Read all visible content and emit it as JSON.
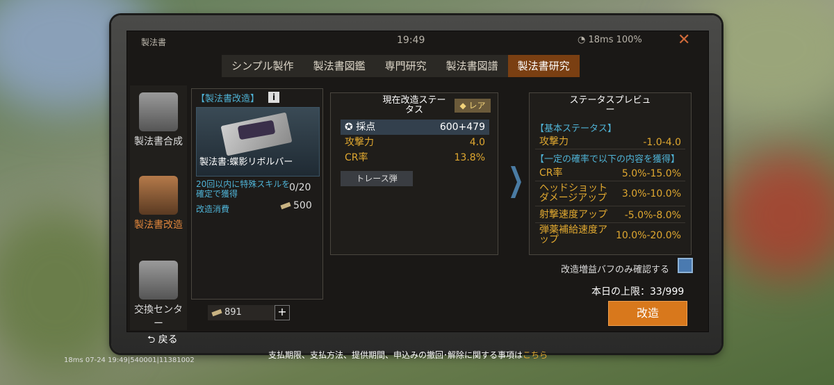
{
  "topbar": {
    "title": "製法書",
    "time": "19:49",
    "status": "18ms 100%",
    "close": "✕"
  },
  "tabs": [
    "シンプル製作",
    "製法書図鑑",
    "専門研究",
    "製法書図譜",
    "製法書研究"
  ],
  "sidebar": [
    {
      "label": "製法書合成"
    },
    {
      "label": "製法書改造"
    },
    {
      "label": "交換センター"
    }
  ],
  "left": {
    "header": "【製法書改造】",
    "info": "i",
    "item_name": "製法書:蝶影リボルバー",
    "condition": "20回以内に特殊スキルを確定で獲得",
    "condition_value": "0/20",
    "cost_label": "改造消費",
    "cost_value": "500"
  },
  "current": {
    "title": "現在改造ステータス",
    "rarity": "レア",
    "rows": [
      {
        "k": "採点",
        "v": "600+479"
      },
      {
        "k": "攻撃力",
        "v": "4.0"
      },
      {
        "k": "CR率",
        "v": "13.8%"
      }
    ],
    "trace": "トレース弾"
  },
  "preview": {
    "title": "ステータスプレビュー",
    "basic": "【基本ステータス】",
    "atk": {
      "k": "攻撃力",
      "v": "-1.0-4.0"
    },
    "chance": "【一定の確率で以下の内容を獲得】",
    "rows": [
      {
        "k": "CR率",
        "v": "5.0%-15.0%"
      },
      {
        "k": "ヘッドショットダメージアップ",
        "v": "3.0%-10.0%"
      },
      {
        "k": "射撃速度アップ",
        "v": "-5.0%-8.0%"
      },
      {
        "k": "弾薬補給速度アップ",
        "v": "10.0%-20.0%"
      }
    ]
  },
  "check_label": "改造増益バフのみ確認する",
  "daily_limit": "本日の上限：33/999",
  "kaizo_button": "改造",
  "balance": "891",
  "plus": "+",
  "back": "戻る",
  "footer": {
    "text": "支払期限、支払方法、提供期間、申込みの撤回･解除に関する事項は",
    "link": "こちら"
  },
  "debug": "18ms 07-24 19:49|540001|11381002",
  "colors": {
    "accent": "#d8781c",
    "blue": "#4fb3d6",
    "gold": "#e0a830"
  }
}
